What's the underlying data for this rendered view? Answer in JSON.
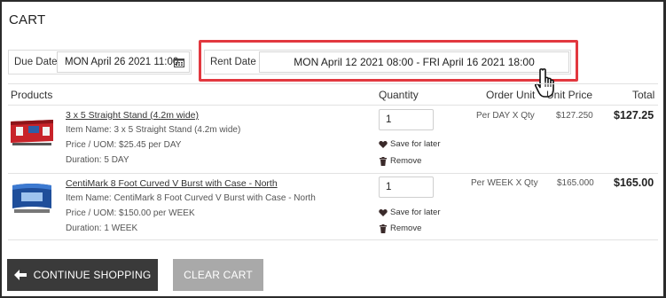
{
  "cart": {
    "title": "CART"
  },
  "dates": {
    "due_label": "Due Date",
    "due_value": "MON April 26 2021 11:00",
    "rent_label": "Rent Date",
    "rent_value": "MON April 12 2021 08:00 - FRI April 16 2021 18:00"
  },
  "table": {
    "headers": {
      "products": "Products",
      "quantity": "Quantity",
      "order_unit": "Order Unit",
      "unit_price": "Unit Price",
      "total": "Total"
    },
    "rows": [
      {
        "name": "3 x 5 Straight Stand (4.2m wide)",
        "item_name": "Item Name: 3 x 5 Straight Stand (4.2m wide)",
        "price_uom": "Price / UOM: $25.45 per DAY",
        "duration": "Duration: 5 DAY",
        "quantity": "1",
        "save_label": "Save for later",
        "remove_label": "Remove",
        "order_unit": "Per DAY X Qty",
        "unit_price": "$127.250",
        "total": "$127.25"
      },
      {
        "name": "CentiMark 8 Foot Curved V Burst with Case - North",
        "item_name": "Item Name: CentiMark 8 Foot Curved V Burst with Case - North",
        "price_uom": "Price / UOM: $150.00 per WEEK",
        "duration": "Duration: 1 WEEK",
        "quantity": "1",
        "save_label": "Save for later",
        "remove_label": "Remove",
        "order_unit": "Per WEEK X Qty",
        "unit_price": "$165.000",
        "total": "$165.00"
      }
    ]
  },
  "buttons": {
    "continue_label": "CONTINUE SHOPPING",
    "clear_label": "CLEAR CART"
  },
  "icons": {
    "calendar": "calendar-icon",
    "cursor": "hand-pointer-icon",
    "heart": "heart-icon",
    "trash": "trash-icon",
    "back_arrow": "arrow-left-icon"
  },
  "colors": {
    "highlight": "#e2383f",
    "continue_button": "#3a3a3a",
    "clear_button": "#a9a9a9"
  }
}
